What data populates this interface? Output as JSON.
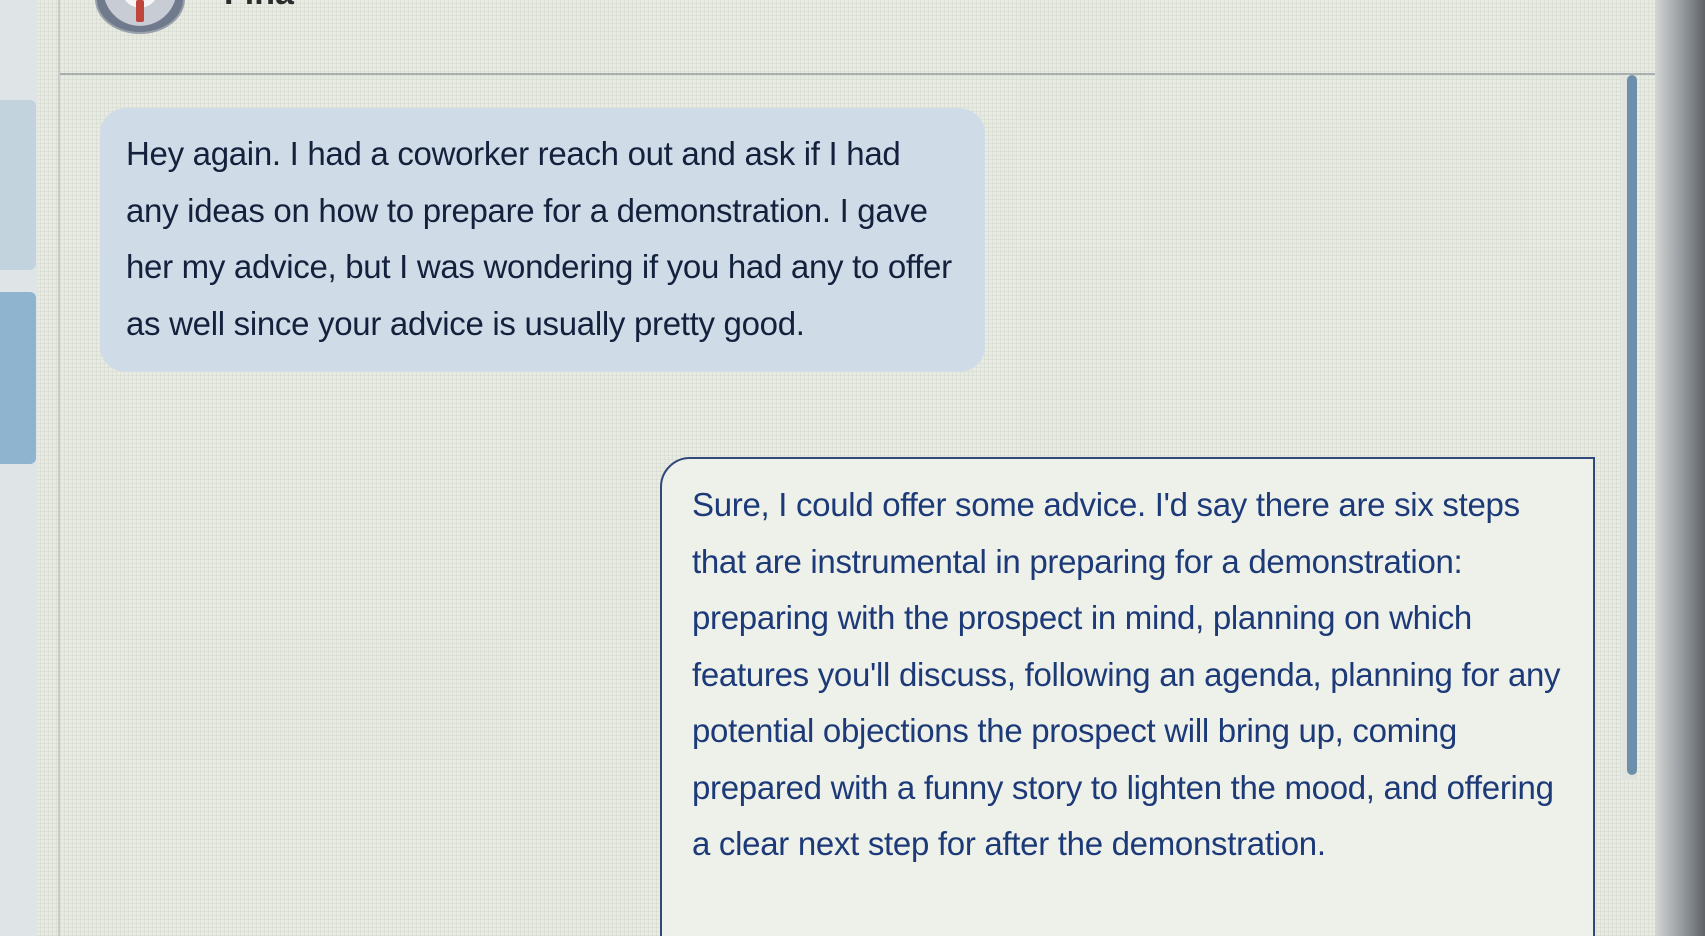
{
  "conversation": {
    "contact_name": "Fina",
    "messages": [
      {
        "sender": "user",
        "text": "Hey again. I had a coworker reach out and ask if I had any ideas on how to prepare for a demonstration. I gave her my advice, but I was wondering if you had any to offer as well since your advice is usually pretty good."
      },
      {
        "sender": "assistant",
        "text": "Sure, I could offer some advice. I'd say there are six steps that are instrumental in preparing for a demonstration: preparing with the prospect in mind, planning on which features you'll discuss, following an agenda, planning for any potential objections the prospect will bring up, coming prepared with a funny story to lighten the mood, and offering a clear next step for after the demonstration."
      }
    ]
  },
  "colors": {
    "user_bubble": "#cfdbe6",
    "reply_border": "#2f4a78",
    "reply_text": "#1d3a78",
    "scrollbar": "#6d8fa9"
  },
  "icons": {
    "avatar": "contact-avatar-icon"
  }
}
